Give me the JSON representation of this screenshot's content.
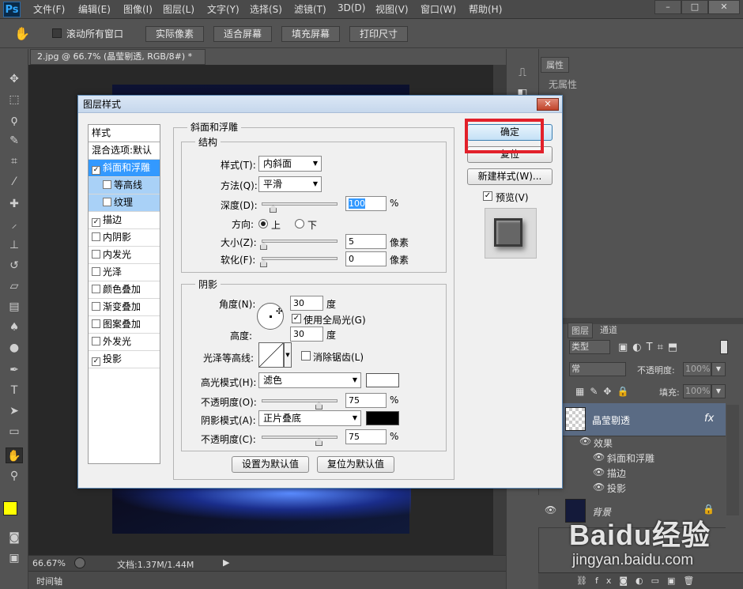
{
  "app": {
    "logo": "Ps"
  },
  "menubar": {
    "items": [
      "文件(F)",
      "编辑(E)",
      "图像(I)",
      "图层(L)",
      "文字(Y)",
      "选择(S)",
      "滤镜(T)",
      "3D(D)",
      "视图(V)",
      "窗口(W)",
      "帮助(H)"
    ],
    "min": "–",
    "max": "□",
    "close": "✕"
  },
  "options": {
    "hand": "✋",
    "scroll_all": "滚动所有窗口",
    "actual_pixels": "实际像素",
    "fit_screen": "适合屏幕",
    "fill_screen": "填充屏幕",
    "print_size": "打印尺寸"
  },
  "document": {
    "tab": "2.jpg @ 66.7% (晶莹剔透, RGB/8#) *",
    "tab_close": "×"
  },
  "status": {
    "zoom": "66.67%",
    "doc_size": "文档:1.37M/1.44M",
    "play": "▶"
  },
  "timeline": {
    "label": "时间轴"
  },
  "properties": {
    "tab": "属性",
    "content": "无属性"
  },
  "layers": {
    "tabs": [
      "图层",
      "通道"
    ],
    "kind": "类型",
    "blend": "常",
    "opacity_label": "不透明度:",
    "opacity_value": "100%",
    "lock_label": "锁定:",
    "fill_label": "填充:",
    "fill_value": "100%",
    "layer1_name": "晶莹剔透",
    "fx": "fx",
    "effects_label": "效果",
    "effects": [
      "斜面和浮雕",
      "描边",
      "投影"
    ],
    "bg_name": "背景"
  },
  "dialog": {
    "title": "图层样式",
    "close": "✕",
    "styles_header": "样式",
    "blend_options": "混合选项:默认",
    "styles": [
      {
        "label": "斜面和浮雕",
        "checked": true
      },
      {
        "label": "等高线",
        "checked": false
      },
      {
        "label": "纹理",
        "checked": false
      },
      {
        "label": "描边",
        "checked": true
      },
      {
        "label": "内阴影",
        "checked": false
      },
      {
        "label": "内发光",
        "checked": false
      },
      {
        "label": "光泽",
        "checked": false
      },
      {
        "label": "颜色叠加",
        "checked": false
      },
      {
        "label": "渐变叠加",
        "checked": false
      },
      {
        "label": "图案叠加",
        "checked": false
      },
      {
        "label": "外发光",
        "checked": false
      },
      {
        "label": "投影",
        "checked": true
      }
    ],
    "bevel": {
      "title": "斜面和浮雕",
      "structure": "结构",
      "style_label": "样式(T):",
      "style_value": "内斜面",
      "method_label": "方法(Q):",
      "method_value": "平滑",
      "depth_label": "深度(D):",
      "depth_value": "100",
      "pct": "%",
      "direction_label": "方向:",
      "dir_up": "上",
      "dir_down": "下",
      "size_label": "大小(Z):",
      "size_value": "5",
      "px": "像素",
      "soften_label": "软化(F):",
      "soften_value": "0"
    },
    "shading": {
      "title": "阴影",
      "angle_label": "角度(N):",
      "angle_value": "30",
      "deg": "度",
      "global_light": "使用全局光(G)",
      "altitude_label": "高度:",
      "altitude_value": "30",
      "gloss_label": "光泽等高线:",
      "anti_alias": "消除锯齿(L)",
      "hl_mode_label": "高光模式(H):",
      "hl_mode_value": "滤色",
      "hl_opacity_label": "不透明度(O):",
      "hl_opacity_value": "75",
      "sh_mode_label": "阴影模式(A):",
      "sh_mode_value": "正片叠底",
      "sh_opacity_label": "不透明度(C):",
      "sh_opacity_value": "75",
      "hl_color": "#ffffff",
      "sh_color": "#000000"
    },
    "set_default": "设置为默认值",
    "reset_default": "复位为默认值",
    "ok": "确定",
    "reset": "复位",
    "new_style": "新建样式(W)...",
    "preview": "预览(V)"
  },
  "watermark": {
    "text": "Baidu经验",
    "url": "jingyan.baidu.com"
  },
  "colors": {
    "fg": "#ffff00",
    "bg": "#ffffff",
    "highlight_box": "#e2202a"
  }
}
